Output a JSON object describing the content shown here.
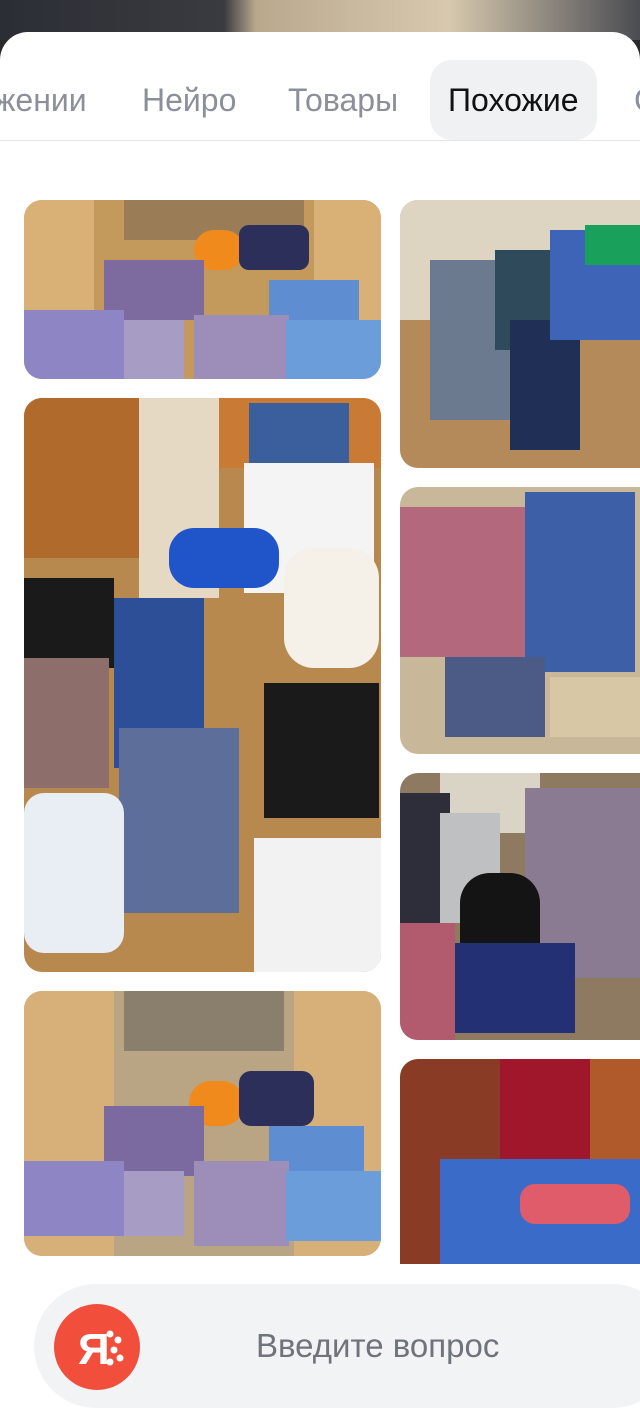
{
  "tabs": [
    {
      "label": "жении"
    },
    {
      "label": "Нейро"
    },
    {
      "label": "Товары"
    },
    {
      "label": "Похожие",
      "active": true
    },
    {
      "label": "С"
    }
  ],
  "images": {
    "left": [
      {
        "alt": "Truck loaded with checkered bags"
      },
      {
        "alt": "Room with checkered bags, bucket and boxes"
      },
      {
        "alt": "Truck loaded with checkered bags (duplicate)"
      }
    ],
    "right": [
      {
        "alt": "Checkered bags in a room"
      },
      {
        "alt": "Large checkered bags stacked"
      },
      {
        "alt": "Checkered bags and boxes"
      },
      {
        "alt": "Blue checkered bag near door"
      }
    ]
  },
  "search": {
    "placeholder": "Введите вопрос",
    "logo_icon": "yandex-alice-icon",
    "logo_color": "#f24e3c"
  }
}
